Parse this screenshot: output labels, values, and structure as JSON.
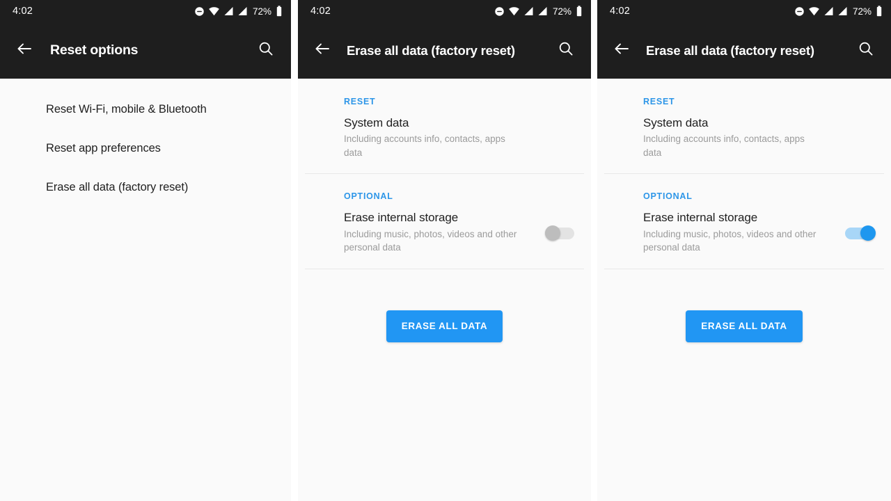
{
  "status_bar": {
    "time": "4:02",
    "battery_percent": "72%",
    "icons": [
      "dnd-icon",
      "wifi-icon",
      "signal-icon",
      "signal-icon",
      "battery-icon"
    ]
  },
  "colors": {
    "accent": "#2196f3",
    "section_header": "#2d96e8",
    "appbar_bg": "#1e1e1e",
    "content_bg": "#fafafa",
    "toggle_on_thumb": "#1e97ef",
    "toggle_on_track": "#a8d6f7",
    "toggle_off_thumb": "#bdbdbd",
    "toggle_off_track": "#e3e3e3"
  },
  "panels": [
    {
      "id": "reset-options",
      "appbar": {
        "title": "Reset options",
        "back_icon": "arrow-left-icon",
        "search_icon": "search-icon"
      },
      "list_items": [
        "Reset Wi-Fi, mobile & Bluetooth",
        "Reset app preferences",
        "Erase all data (factory reset)"
      ]
    },
    {
      "id": "erase-all-data-toggle-off",
      "appbar": {
        "title": "Erase all data (factory reset)",
        "back_icon": "arrow-left-icon",
        "search_icon": "search-icon"
      },
      "sections": [
        {
          "header": "RESET",
          "row_title": "System data",
          "row_subtitle": "Including accounts info, contacts, apps data"
        },
        {
          "header": "OPTIONAL",
          "row_title": "Erase internal storage",
          "row_subtitle": "Including music, photos, videos and other personal data",
          "toggle_state": "off"
        }
      ],
      "button_label": "ERASE ALL DATA"
    },
    {
      "id": "erase-all-data-toggle-on",
      "appbar": {
        "title": "Erase all data (factory reset)",
        "back_icon": "arrow-left-icon",
        "search_icon": "search-icon"
      },
      "sections": [
        {
          "header": "RESET",
          "row_title": "System data",
          "row_subtitle": "Including accounts info, contacts, apps data"
        },
        {
          "header": "OPTIONAL",
          "row_title": "Erase internal storage",
          "row_subtitle": "Including music, photos, videos and other personal data",
          "toggle_state": "on"
        }
      ],
      "button_label": "ERASE ALL DATA"
    }
  ]
}
